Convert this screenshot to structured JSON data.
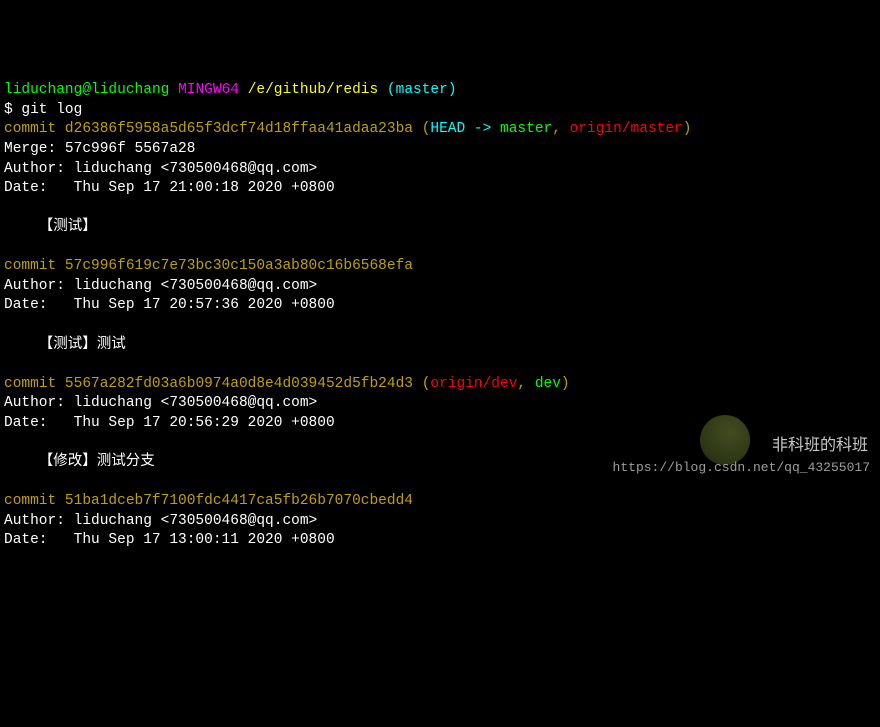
{
  "prompt": {
    "user": "liduchang",
    "host": "liduchang",
    "shell": "MINGW64",
    "cwd": "/e/github/redis",
    "branch": "master"
  },
  "command": "$ git log",
  "commits": [
    {
      "hash": "d26386f5958a5d65f3dcf74d18ffaa41adaa23ba",
      "refs_open": "(",
      "refs_head": "HEAD -> ",
      "refs_master": "master",
      "refs_sep": ", ",
      "refs_origin": "origin/master",
      "refs_close": ")",
      "merge": "Merge: 57c996f 5567a28",
      "author": "Author: liduchang <730500468@qq.com>",
      "date": "Date:   Thu Sep 17 21:00:18 2020 +0800",
      "message": "    【测试】"
    },
    {
      "hash": "57c996f619c7e73bc30c150a3ab80c16b6568efa",
      "author": "Author: liduchang <730500468@qq.com>",
      "date": "Date:   Thu Sep 17 20:57:36 2020 +0800",
      "message": "    【测试】测试"
    },
    {
      "hash": "5567a282fd03a6b0974a0d8e4d039452d5fb24d3",
      "refs_open": "(",
      "refs_origin_dev": "origin/dev",
      "refs_sep": ", ",
      "refs_dev": "dev",
      "refs_close": ")",
      "author": "Author: liduchang <730500468@qq.com>",
      "date": "Date:   Thu Sep 17 20:56:29 2020 +0800",
      "message": "    【修改】测试分支"
    },
    {
      "hash": "51ba1dceb7f7100fdc4417ca5fb26b7070cbedd4",
      "author": "Author: liduchang <730500468@qq.com>",
      "date": "Date:   Thu Sep 17 13:00:11 2020 +0800"
    }
  ],
  "watermark": {
    "text": "非科班的科班",
    "url": "https://blog.csdn.net/qq_43255017"
  }
}
